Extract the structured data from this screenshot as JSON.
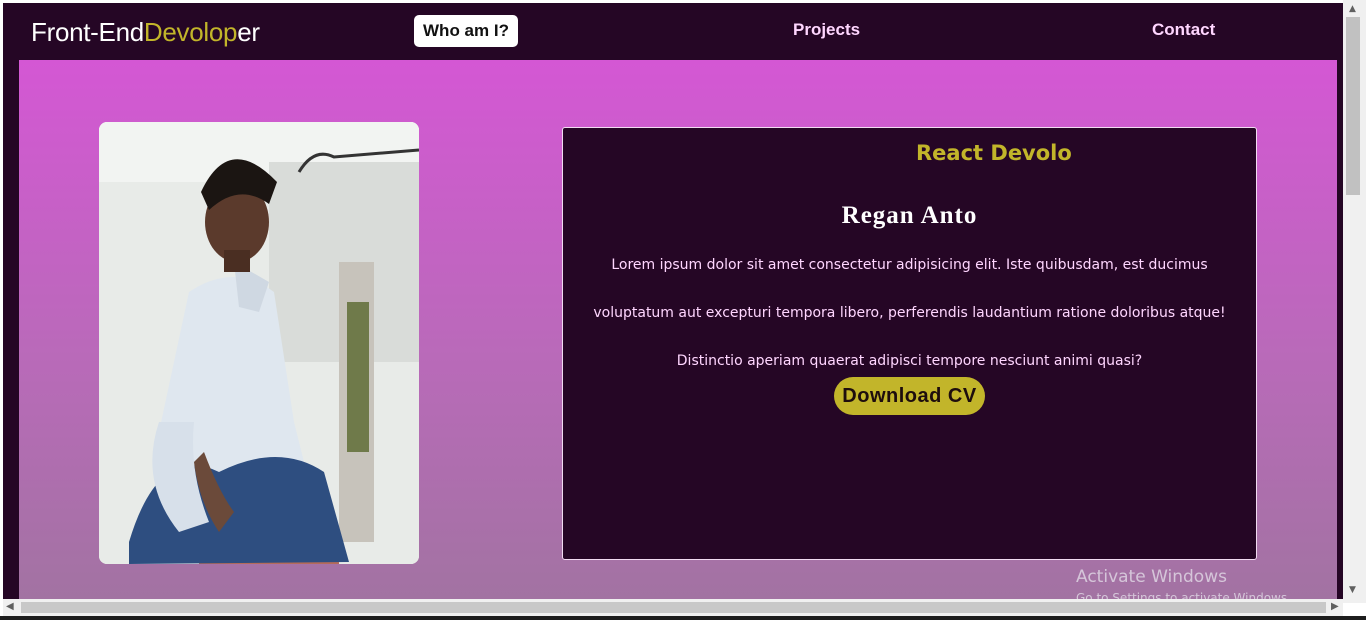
{
  "nav": {
    "brand_prefix": "Front-End",
    "brand_accent": "Devolop",
    "brand_suffix": "er",
    "links": [
      {
        "label": "Who am I?",
        "active": true
      },
      {
        "label": "Projects"
      },
      {
        "label": "Contact"
      }
    ]
  },
  "profile": {
    "role": "React Devolop",
    "name": "Regan Anto",
    "bio_lines": [
      "Lorem ipsum dolor sit amet consectetur adipisicing elit. Iste quibusdam, est ducimus",
      "voluptatum aut excepturi tempora libero, perferendis laudantium ratione doloribus atque!",
      "Distinctio aperiam quaerat adipisci tempore nesciunt animi quasi?"
    ],
    "cv_button": "Download CV"
  },
  "watermark": {
    "title": "Activate Windows",
    "subtitle": "Go to Settings to activate Windows."
  },
  "colors": {
    "nav_bg": "#250625",
    "accent": "#c2b52a",
    "hero_top": "#d457d4",
    "hero_bottom": "#a273a2",
    "link": "#ffd6ff"
  }
}
